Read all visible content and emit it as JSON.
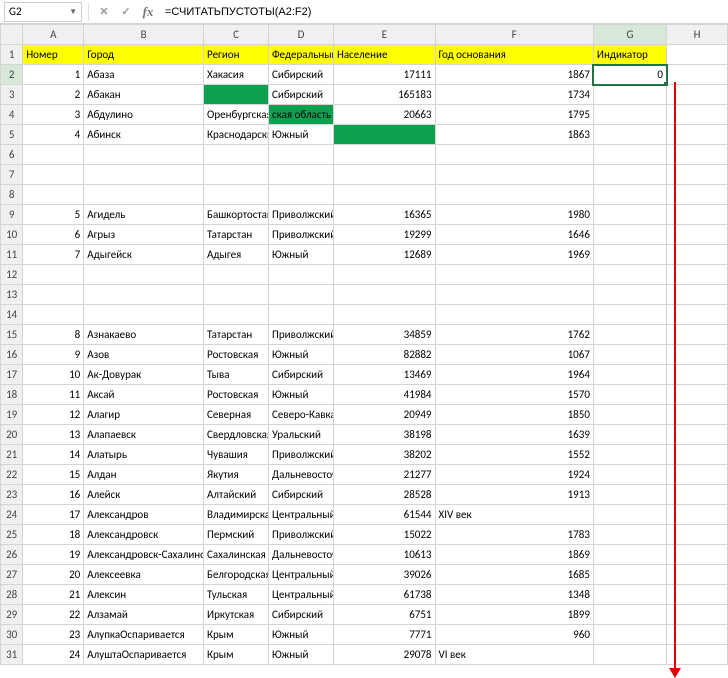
{
  "nameBox": "G2",
  "formula": "=СЧИТАТЬПУСТОТЫ(A2:F2)",
  "colHeaders": [
    "A",
    "B",
    "C",
    "D",
    "E",
    "F",
    "G",
    "H"
  ],
  "rowHeaders": [
    "1",
    "2",
    "3",
    "4",
    "5",
    "6",
    "7",
    "8",
    "9",
    "10",
    "11",
    "12",
    "13",
    "14",
    "15",
    "16",
    "17",
    "18",
    "19",
    "20",
    "21",
    "22",
    "23",
    "24",
    "25",
    "26",
    "27",
    "28",
    "29",
    "30",
    "31"
  ],
  "header": {
    "A": "Номер",
    "B": "Город",
    "C": "Регион",
    "D": "Федеральный",
    "E": "Население",
    "F": "Год основания",
    "G": "Индикатор"
  },
  "rows": [
    {
      "n": "1",
      "city": "Абаза",
      "reg": "Хакасия",
      "fed": "Сибирский",
      "pop": "17111",
      "yr": "1867",
      "ind": "0",
      "sel": true
    },
    {
      "n": "2",
      "city": "Абакан",
      "reg": "",
      "fed": "Сибирский",
      "pop": "165183",
      "yr": "1734",
      "greenC": true
    },
    {
      "n": "3",
      "city": "Абдулино",
      "reg": "Оренбургская",
      "fed": "ская область",
      "pop": "20663",
      "yr": "1795",
      "greenD": true
    },
    {
      "n": "4",
      "city": "Абинск",
      "reg": "Краснодарский",
      "fed": "Южный",
      "pop": "",
      "yr": "1863",
      "greenE": true
    },
    {
      "blank": true
    },
    {
      "blank": true
    },
    {
      "blank": true
    },
    {
      "n": "5",
      "city": "Агидель",
      "reg": "Башкортостан",
      "fed": "Приволжский",
      "pop": "16365",
      "yr": "1980"
    },
    {
      "n": "6",
      "city": "Агрыз",
      "reg": "Татарстан",
      "fed": "Приволжский",
      "pop": "19299",
      "yr": "1646"
    },
    {
      "n": "7",
      "city": "Адыгейск",
      "reg": "Адыгея",
      "fed": "Южный",
      "pop": "12689",
      "yr": "1969"
    },
    {
      "blank": true
    },
    {
      "blank": true
    },
    {
      "blank": true
    },
    {
      "n": "8",
      "city": "Азнакаево",
      "reg": "Татарстан",
      "fed": "Приволжский",
      "pop": "34859",
      "yr": "1762"
    },
    {
      "n": "9",
      "city": "Азов",
      "reg": "Ростовская",
      "fed": "Южный",
      "pop": "82882",
      "yr": "1067"
    },
    {
      "n": "10",
      "city": "Ак-Довурак",
      "reg": "Тыва",
      "fed": "Сибирский",
      "pop": "13469",
      "yr": "1964"
    },
    {
      "n": "11",
      "city": "Аксай",
      "reg": "Ростовская",
      "fed": "Южный",
      "pop": "41984",
      "yr": "1570"
    },
    {
      "n": "12",
      "city": "Алагир",
      "reg": "Северная",
      "fed": "Северо-Кавказский",
      "pop": "20949",
      "yr": "1850"
    },
    {
      "n": "13",
      "city": "Алапаевск",
      "reg": "Свердловская",
      "fed": "Уральский",
      "pop": "38198",
      "yr": "1639"
    },
    {
      "n": "14",
      "city": "Алатырь",
      "reg": "Чувашия",
      "fed": "Приволжский",
      "pop": "38202",
      "yr": "1552"
    },
    {
      "n": "15",
      "city": "Алдан",
      "reg": "Якутия",
      "fed": "Дальневосточный",
      "pop": "21277",
      "yr": "1924"
    },
    {
      "n": "16",
      "city": "Алейск",
      "reg": "Алтайский",
      "fed": "Сибирский",
      "pop": "28528",
      "yr": "1913"
    },
    {
      "n": "17",
      "city": "Александров",
      "reg": "Владимирская",
      "fed": "Центральный",
      "pop": "61544",
      "yr": "XIV век",
      "yrText": true
    },
    {
      "n": "18",
      "city": "Александровск",
      "reg": "Пермский",
      "fed": "Приволжский",
      "pop": "15022",
      "yr": "1783"
    },
    {
      "n": "19",
      "city": "Александровск-Сахалинский",
      "reg": "Сахалинская",
      "fed": "Дальневосточный",
      "pop": "10613",
      "yr": "1869"
    },
    {
      "n": "20",
      "city": "Алексеевка",
      "reg": "Белгородская",
      "fed": "Центральный",
      "pop": "39026",
      "yr": "1685"
    },
    {
      "n": "21",
      "city": "Алексин",
      "reg": "Тульская",
      "fed": "Центральный",
      "pop": "61738",
      "yr": "1348"
    },
    {
      "n": "22",
      "city": "Алзамай",
      "reg": "Иркутская",
      "fed": "Сибирский",
      "pop": "6751",
      "yr": "1899"
    },
    {
      "n": "23",
      "city": "АлупкаОспаривается",
      "reg": "Крым",
      "fed": "Южный",
      "pop": "7771",
      "yr": "960"
    },
    {
      "n": "24",
      "city": "АлуштаОспаривается",
      "reg": "Крым",
      "fed": "Южный",
      "pop": "29078",
      "yr": "VI век",
      "yrText": true
    }
  ]
}
